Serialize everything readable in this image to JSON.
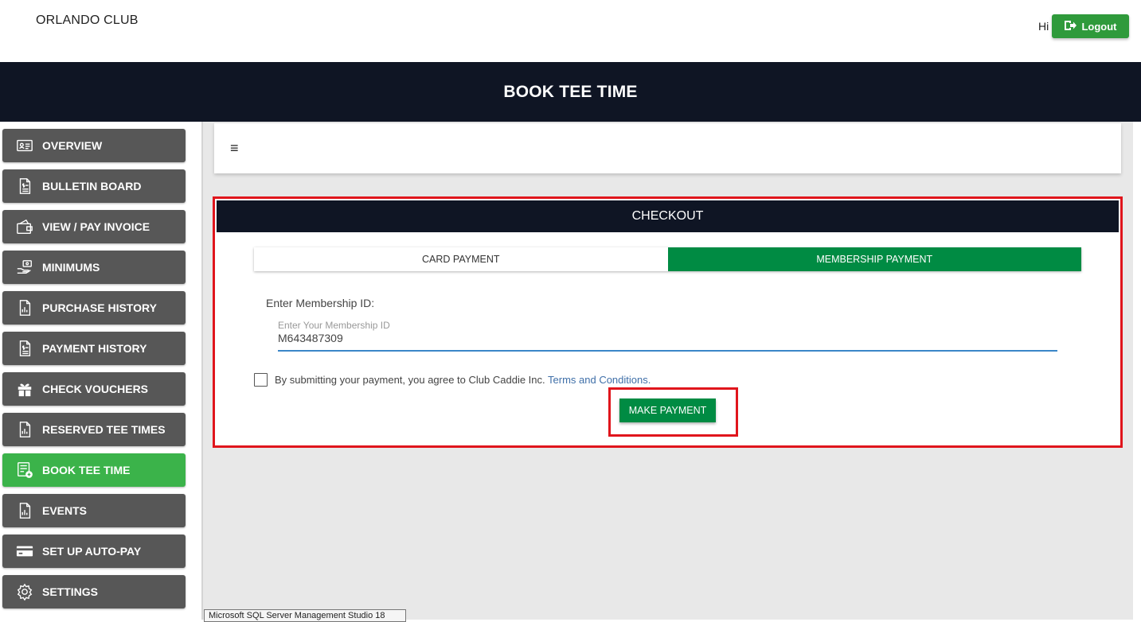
{
  "app": {
    "club_name": "ORLANDO CLUB",
    "greeting": "Hi",
    "logout_label": "Logout",
    "page_title": "BOOK TEE TIME"
  },
  "sidebar": {
    "items": [
      {
        "label": "OVERVIEW",
        "icon": "id-card-icon"
      },
      {
        "label": "BULLETIN BOARD",
        "icon": "document-dollar-icon"
      },
      {
        "label": "VIEW / PAY INVOICE",
        "icon": "wallet-icon"
      },
      {
        "label": "MINIMUMS",
        "icon": "cash-hand-icon"
      },
      {
        "label": "PURCHASE HISTORY",
        "icon": "report-chart-icon"
      },
      {
        "label": "PAYMENT HISTORY",
        "icon": "document-dollar-icon"
      },
      {
        "label": "CHECK VOUCHERS",
        "icon": "gift-icon"
      },
      {
        "label": "RESERVED TEE TIMES",
        "icon": "report-chart-icon"
      },
      {
        "label": "BOOK TEE TIME",
        "icon": "list-plus-icon",
        "active": true
      },
      {
        "label": "EVENTS",
        "icon": "report-chart-icon"
      },
      {
        "label": "SET UP AUTO-PAY",
        "icon": "credit-card-icon"
      },
      {
        "label": "SETTINGS",
        "icon": "gear-icon"
      }
    ]
  },
  "menu": {
    "icon": "hamburger-icon",
    "glyph": "≡"
  },
  "checkout": {
    "title": "CHECKOUT",
    "tabs": {
      "card": "CARD PAYMENT",
      "membership": "MEMBERSHIP PAYMENT",
      "selected": "membership"
    },
    "membership_label": "Enter Membership ID:",
    "membership_placeholder": "Enter Your Membership ID",
    "membership_value": "M643487309",
    "agreement_text": "By submitting your payment, you agree to Club Caddie Inc.",
    "terms_link": "Terms and Conditions.",
    "agreement_checked": false,
    "submit_label": "MAKE PAYMENT"
  },
  "taskbar_tooltip": "Microsoft SQL Server Management Studio 18",
  "colors": {
    "header_bg": "#0f1524",
    "accent_green": "#008b43",
    "active_side_green": "#3bb34a",
    "sidebar_item_bg": "#575757",
    "highlight_red": "#e0151c",
    "link_blue": "#3f6fa8"
  }
}
